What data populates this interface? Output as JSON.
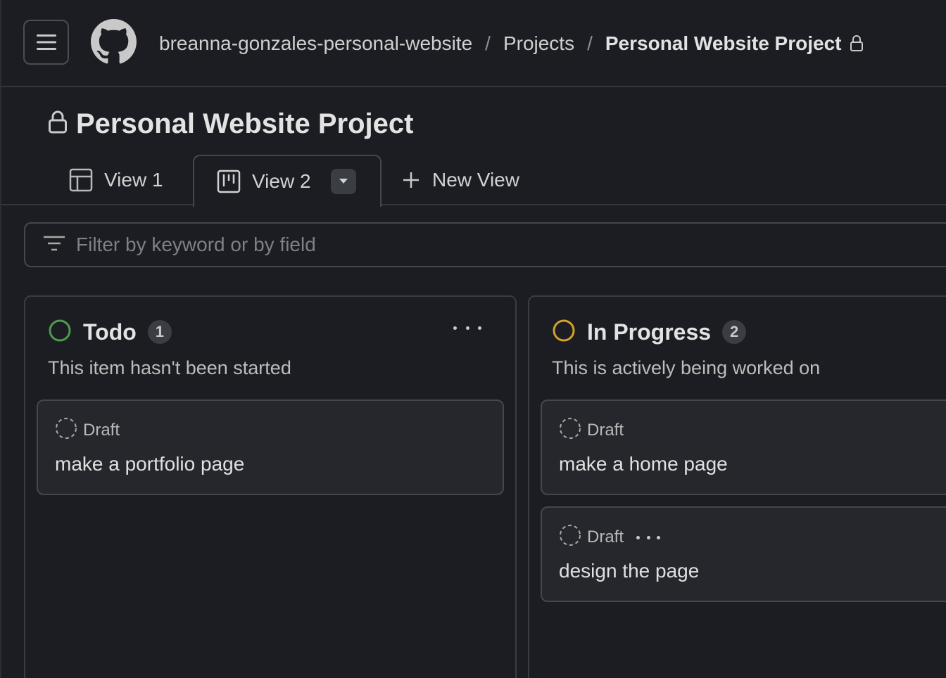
{
  "header": {
    "breadcrumb": {
      "owner": "breanna-gonzales-personal-website",
      "section": "Projects",
      "current": "Personal Website Project",
      "separator": "/"
    }
  },
  "project": {
    "title": "Personal Website Project"
  },
  "tabs": [
    {
      "label": "View 1",
      "icon": "table-icon",
      "active": false
    },
    {
      "label": "View 2",
      "icon": "board-icon",
      "active": true
    },
    {
      "label": "New View",
      "icon": "plus-icon",
      "active": false
    }
  ],
  "filter": {
    "placeholder": "Filter by keyword or by field"
  },
  "columns": [
    {
      "name": "Todo",
      "count": "1",
      "description": "This item hasn't been started",
      "status_color": "#4e9a4f",
      "cards": [
        {
          "type": "Draft",
          "title": "make a portfolio page"
        }
      ]
    },
    {
      "name": "In Progress",
      "count": "2",
      "description": "This is actively being worked on",
      "status_color": "#d3a12a",
      "cards": [
        {
          "type": "Draft",
          "title": "make a home page"
        },
        {
          "type": "Draft",
          "title": "design the page"
        }
      ]
    }
  ]
}
